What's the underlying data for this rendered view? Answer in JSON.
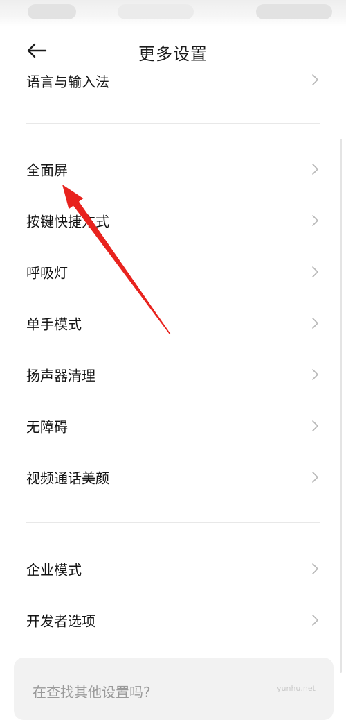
{
  "header": {
    "title": "更多设置"
  },
  "top_partial_row": {
    "label": "语言与输入法"
  },
  "group1": [
    {
      "label": "全面屏",
      "name": "row-full-screen"
    },
    {
      "label": "按键快捷方式",
      "name": "row-button-shortcuts"
    },
    {
      "label": "呼吸灯",
      "name": "row-breathing-light"
    },
    {
      "label": "单手模式",
      "name": "row-one-hand-mode"
    },
    {
      "label": "扬声器清理",
      "name": "row-speaker-cleaning"
    },
    {
      "label": "无障碍",
      "name": "row-accessibility"
    },
    {
      "label": "视频通话美颜",
      "name": "row-video-call-beauty"
    }
  ],
  "group2": [
    {
      "label": "企业模式",
      "name": "row-enterprise-mode"
    },
    {
      "label": "开发者选项",
      "name": "row-developer-options"
    }
  ],
  "search_card": {
    "hint": "在查找其他设置吗?"
  },
  "watermark": "yunhu.net",
  "colors": {
    "annotation_arrow": "#e8231e",
    "chevron": "#b8b8b8",
    "divider": "#e8e8e8"
  },
  "icons": {
    "back": "arrow-left-icon",
    "chevron": "chevron-right-icon"
  }
}
